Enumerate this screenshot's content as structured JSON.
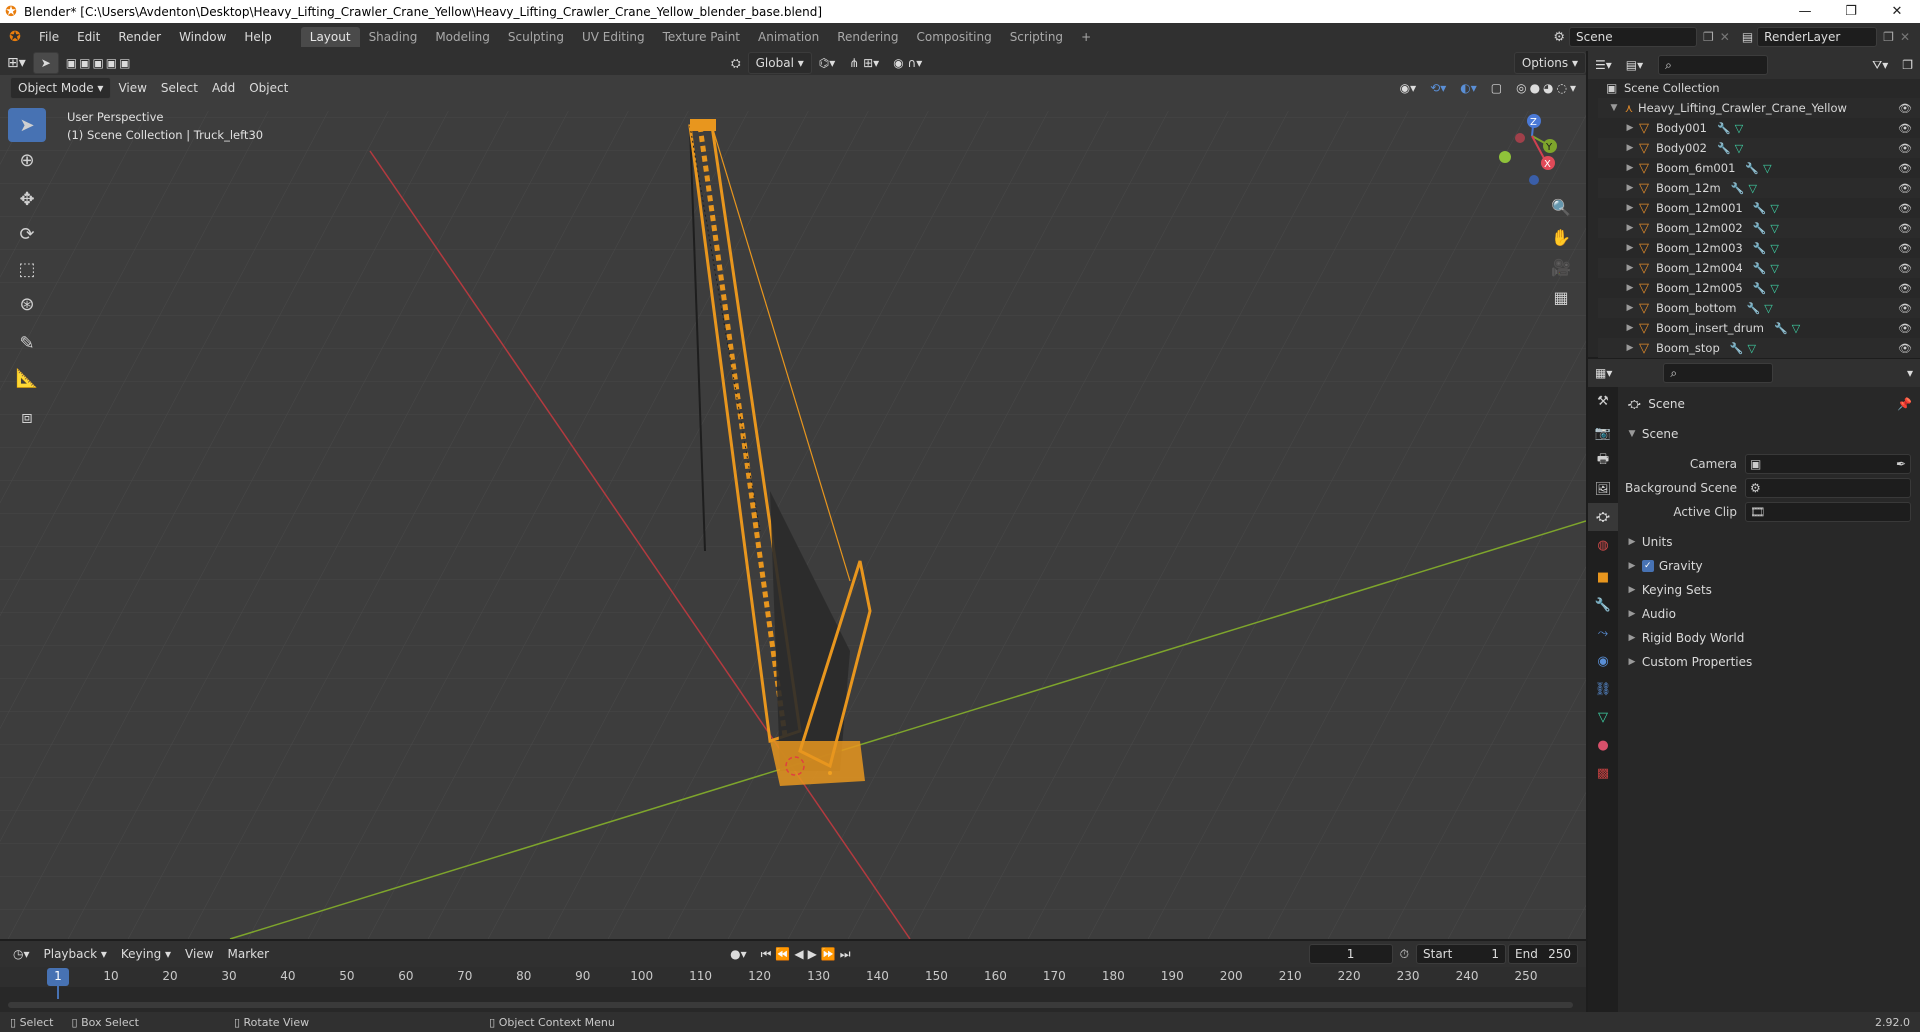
{
  "window": {
    "title": "Blender* [C:\\Users\\Avdenton\\Desktop\\Heavy_Lifting_Crawler_Crane_Yellow\\Heavy_Lifting_Crawler_Crane_Yellow_blender_base.blend]",
    "minimize": "—",
    "maximize": "❐",
    "close": "✕"
  },
  "menu": {
    "items": [
      "File",
      "Edit",
      "Render",
      "Window",
      "Help"
    ],
    "workspaces": [
      "Layout",
      "Shading",
      "Modeling",
      "Sculpting",
      "UV Editing",
      "Texture Paint",
      "Animation",
      "Rendering",
      "Compositing",
      "Scripting"
    ],
    "active_workspace": "Layout",
    "add_tab": "+",
    "scene": "Scene",
    "view_layer": "RenderLayer"
  },
  "viewport": {
    "mode": "Object Mode",
    "menus": [
      "View",
      "Select",
      "Add",
      "Object"
    ],
    "transform_orientation": "Global",
    "options": "Options",
    "perspective": "User Perspective",
    "collection_info": "(1) Scene Collection | Truck_left30",
    "gizmo": {
      "z": "Z",
      "y": "Y",
      "x": "X"
    }
  },
  "outliner": {
    "root": "Scene Collection",
    "collection": "Heavy_Lifting_Crawler_Crane_Yellow",
    "objects": [
      "Body001",
      "Body002",
      "Boom_6m001",
      "Boom_12m",
      "Boom_12m001",
      "Boom_12m002",
      "Boom_12m003",
      "Boom_12m004",
      "Boom_12m005",
      "Boom_bottom",
      "Boom_insert_drum",
      "Boom_stop"
    ]
  },
  "properties": {
    "context": "Scene",
    "panel": "Scene",
    "fields": [
      {
        "label": "Camera",
        "value": ""
      },
      {
        "label": "Background Scene",
        "value": ""
      },
      {
        "label": "Active Clip",
        "value": ""
      }
    ],
    "sections": [
      "Units",
      "Gravity",
      "Keying Sets",
      "Audio",
      "Rigid Body World",
      "Custom Properties"
    ],
    "gravity_checked": true
  },
  "timeline": {
    "menus": [
      "Playback",
      "Keying",
      "View",
      "Marker"
    ],
    "current_frame": "1",
    "start_label": "Start",
    "start": "1",
    "end_label": "End",
    "end": "250",
    "ticks": [
      "1",
      "10",
      "20",
      "30",
      "40",
      "50",
      "60",
      "70",
      "80",
      "90",
      "100",
      "110",
      "120",
      "130",
      "140",
      "150",
      "160",
      "170",
      "180",
      "190",
      "200",
      "210",
      "220",
      "230",
      "240",
      "250"
    ]
  },
  "status": {
    "select": "Select",
    "box_select": "Box Select",
    "rotate_view": "Rotate View",
    "context_menu": "Object Context Menu",
    "version": "2.92.0"
  },
  "colors": {
    "accent": "#4772b3",
    "crane": "#e8961e",
    "x_axis": "#c8323a",
    "y_axis": "#7fa02c"
  }
}
